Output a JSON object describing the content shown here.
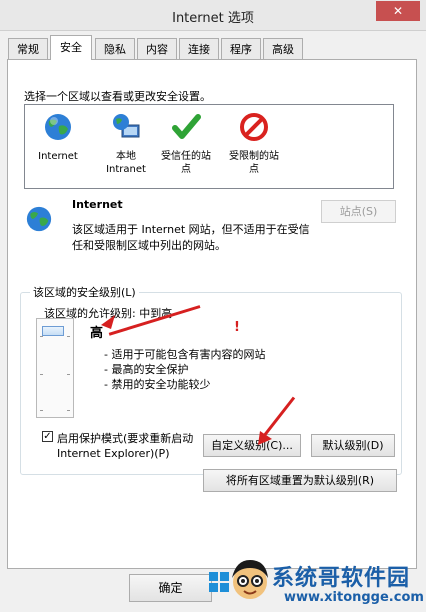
{
  "window": {
    "title": "Internet 选项",
    "close_glyph": "✕"
  },
  "tabs": [
    {
      "label": "常规"
    },
    {
      "label": "安全"
    },
    {
      "label": "隐私"
    },
    {
      "label": "内容"
    },
    {
      "label": "连接"
    },
    {
      "label": "程序"
    },
    {
      "label": "高级"
    }
  ],
  "zones_prompt": "选择一个区域以查看或更改安全设置。",
  "zones": [
    {
      "label": "Internet",
      "icon": "globe-icon"
    },
    {
      "label": "本地\nIntranet",
      "icon": "intranet-icon"
    },
    {
      "label": "受信任的站\n点",
      "icon": "checkmark-icon"
    },
    {
      "label": "受限制的站\n点",
      "icon": "prohibited-icon"
    }
  ],
  "selected_zone": {
    "title": "Internet",
    "description": "该区域适用于 Internet 网站，但不适用于在受信任和受限制区域中列出的网站。",
    "sites_button": "站点(S)"
  },
  "security_level": {
    "group_label": "该区域的安全级别(L)",
    "allowed_levels": "该区域的允许级别: 中到高",
    "level_name": "高",
    "bullets": [
      "- 适用于可能包含有害内容的网站",
      "- 最高的安全保护",
      "- 禁用的安全功能较少"
    ],
    "protected_mode_label": "启用保护模式(要求重新启动 Internet Explorer)(P)",
    "protected_mode_checked": true,
    "custom_button": "自定义级别(C)...",
    "default_button": "默认级别(D)",
    "reset_all_button": "将所有区域重置为默认级别(R)"
  },
  "footer": {
    "ok_button": "确定"
  },
  "watermark": {
    "text": "系统哥软件园",
    "url": "www.xitongge.com"
  },
  "colors": {
    "annotation_arrow": "#d62020",
    "watermark": "#1b5fa8"
  }
}
